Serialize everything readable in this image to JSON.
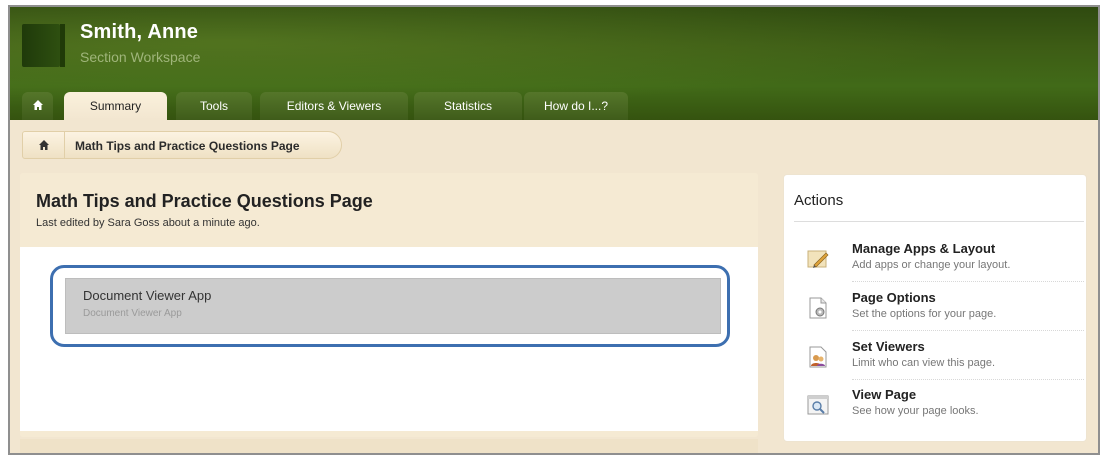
{
  "header": {
    "user_name": "Smith, Anne",
    "workspace": "Section Workspace"
  },
  "tabs": [
    {
      "label": "Summary",
      "active": true
    },
    {
      "label": "Tools",
      "active": false
    },
    {
      "label": "Editors & Viewers",
      "active": false
    },
    {
      "label": "Statistics",
      "active": false
    },
    {
      "label": "How do I...?",
      "active": false
    }
  ],
  "breadcrumb": {
    "current": "Math Tips and Practice Questions Page"
  },
  "page": {
    "title": "Math Tips and Practice Questions Page",
    "edited": "Last edited by Sara Goss about a minute ago."
  },
  "app": {
    "title": "Document Viewer App",
    "subtitle": "Document Viewer App"
  },
  "actions": {
    "title": "Actions",
    "items": [
      {
        "label": "Manage Apps & Layout",
        "desc": "Add apps or change your layout.",
        "icon": "pencil-icon"
      },
      {
        "label": "Page Options",
        "desc": "Set the options for your page.",
        "icon": "page-gear-icon"
      },
      {
        "label": "Set Viewers",
        "desc": "Limit who can view this page.",
        "icon": "users-icon"
      },
      {
        "label": "View Page",
        "desc": "See how your page looks.",
        "icon": "magnifier-icon"
      }
    ]
  },
  "colors": {
    "header_green": "#3d5c15",
    "panel_beige": "#f5ead3",
    "highlight_blue": "#3d6fb0"
  }
}
